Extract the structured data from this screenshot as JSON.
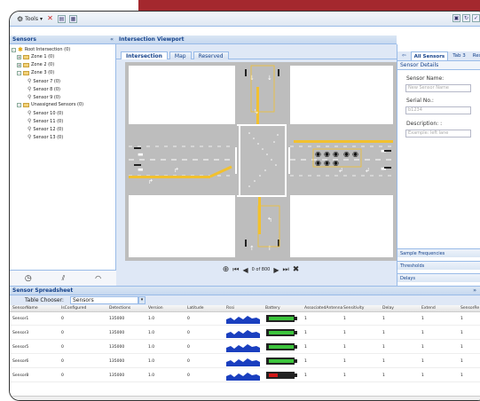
{
  "toolbar": {
    "tools_label": "Tools"
  },
  "left_panel": {
    "title": "Sensors",
    "tree": [
      {
        "label": "Root Intersection (0)",
        "depth": 0,
        "kind": "root"
      },
      {
        "label": "Zone 1 (0)",
        "depth": 1,
        "kind": "folder"
      },
      {
        "label": "Zone 2 (0)",
        "depth": 1,
        "kind": "folder"
      },
      {
        "label": "Zone 3 (0)",
        "depth": 1,
        "kind": "folder"
      },
      {
        "label": "Sensor 7 (0)",
        "depth": 2,
        "kind": "sensor"
      },
      {
        "label": "Sensor 8 (0)",
        "depth": 2,
        "kind": "sensor"
      },
      {
        "label": "Sensor 9 (0)",
        "depth": 2,
        "kind": "sensor"
      },
      {
        "label": "Unassigned Sensors (0)",
        "depth": 1,
        "kind": "folder"
      },
      {
        "label": "Sensor 10 (0)",
        "depth": 2,
        "kind": "sensor"
      },
      {
        "label": "Sensor 11 (0)",
        "depth": 2,
        "kind": "sensor"
      },
      {
        "label": "Sensor 12 (0)",
        "depth": 2,
        "kind": "sensor"
      },
      {
        "label": "Sensor 13 (0)",
        "depth": 2,
        "kind": "sensor"
      }
    ]
  },
  "viewport": {
    "title": "Intersection Viewport",
    "tabs": [
      "Intersection",
      "Map",
      "Reserved"
    ],
    "playback": "0 of 800"
  },
  "side_panel": {
    "tabs": [
      "All Sensors",
      "Tab 3",
      "Rese"
    ],
    "section_title": "Sensor Details",
    "sensor_name_label": "Sensor Name:",
    "sensor_name_placeholder": "New Sensor Name",
    "serial_label": "Serial No.:",
    "serial_placeholder": "b1234",
    "description_label": "Description: :",
    "description_placeholder": "Example: left lane",
    "accordions": [
      "Sample Frequencies",
      "Thresholds",
      "Delays"
    ]
  },
  "spreadsheet": {
    "title": "Sensor Spreadsheet",
    "chooser_label": "Table Chooser:",
    "chooser_value": "Sensors",
    "columns": [
      "SensorName",
      "IsConfigured",
      "Detections",
      "Version",
      "Latitude",
      "Rssi",
      "Battery",
      "AssociatedAntenna",
      "Sensitivity",
      "Delay",
      "Extend",
      "SensorRe"
    ],
    "rows": [
      {
        "name": "Sensor1",
        "configured": "0",
        "detections": "135000",
        "version": "1.0",
        "latitude": "0",
        "battery": "ok",
        "assoc": "1",
        "sensitivity": "1",
        "delay": "1",
        "extend": "1",
        "re": "1"
      },
      {
        "name": "Sensor3",
        "configured": "0",
        "detections": "135000",
        "version": "1.0",
        "latitude": "0",
        "battery": "ok",
        "assoc": "1",
        "sensitivity": "1",
        "delay": "1",
        "extend": "1",
        "re": "1"
      },
      {
        "name": "Sensor5",
        "configured": "0",
        "detections": "135000",
        "version": "1.0",
        "latitude": "0",
        "battery": "ok",
        "assoc": "1",
        "sensitivity": "1",
        "delay": "1",
        "extend": "1",
        "re": "1"
      },
      {
        "name": "Sensor6",
        "configured": "0",
        "detections": "135000",
        "version": "1.0",
        "latitude": "0",
        "battery": "ok",
        "assoc": "1",
        "sensitivity": "1",
        "delay": "1",
        "extend": "1",
        "re": "1"
      },
      {
        "name": "Sensor8",
        "configured": "0",
        "detections": "135000",
        "version": "1.0",
        "latitude": "0",
        "battery": "low",
        "assoc": "1",
        "sensitivity": "1",
        "delay": "1",
        "extend": "1",
        "re": "1"
      }
    ]
  },
  "colors": {
    "accent_red": "#a4282e",
    "panel_header": "#15428b",
    "lane_yellow": "#f2c12e",
    "battery_green": "#3cc43c",
    "battery_red": "#d01818",
    "rssi_blue": "#1a3fbf"
  }
}
